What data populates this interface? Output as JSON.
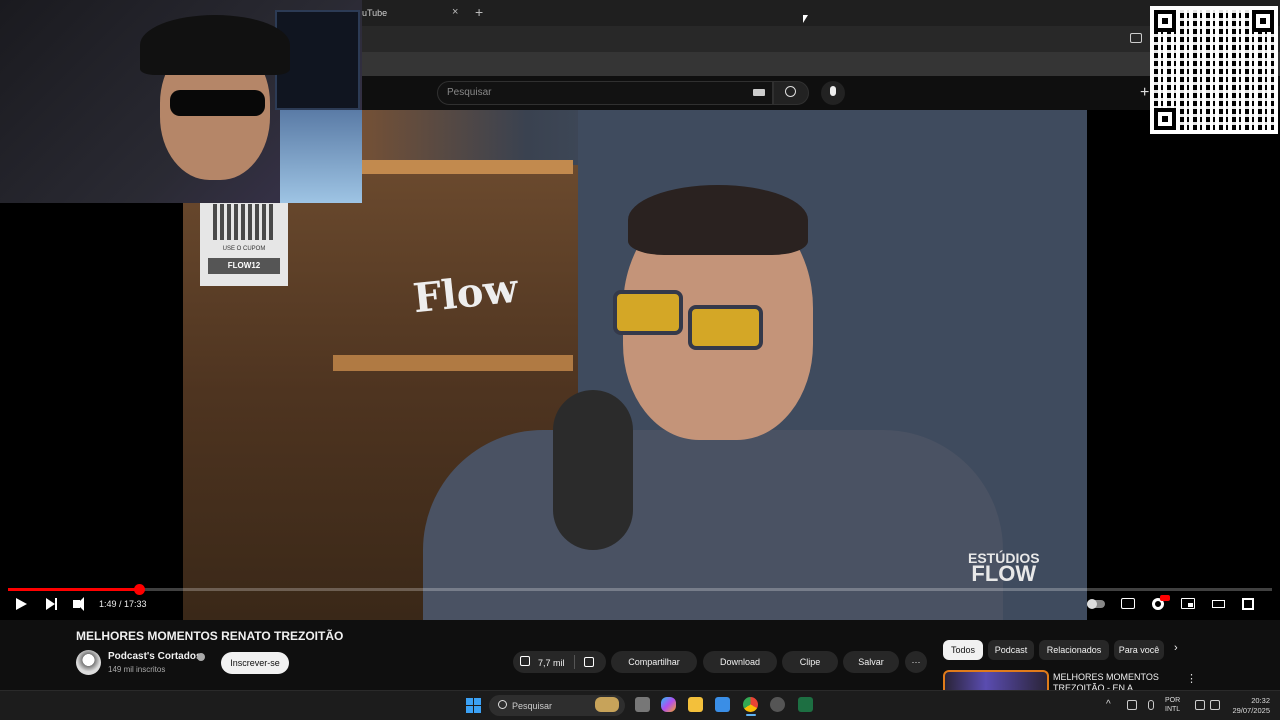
{
  "browser": {
    "tab_title": "uTube",
    "tab_close": "×",
    "new_tab": "+"
  },
  "header": {
    "search_placeholder": "Pesquisar",
    "create": "+"
  },
  "video": {
    "overlay_logo": "Flow",
    "coupon_text": "USE O CUPOM",
    "coupon_code": "FLOW12",
    "studio_line1": "ESTÚDIOS",
    "studio_line2": "FLOW",
    "time": "1:49 / 17:33",
    "progress_fraction": 0.1035
  },
  "meta": {
    "title": "MELHORES MOMENTOS RENATO TREZOITÃO",
    "channel": "Podcast's Cortados",
    "subscribers": "149 mil inscritos",
    "subscribe_label": "Inscrever-se",
    "likes": "7,7 mil",
    "share_label": "Compartilhar",
    "download_label": "Download",
    "clip_label": "Clipe",
    "save_label": "Salvar",
    "more_label": "···"
  },
  "chips": [
    "Todos",
    "Podcast",
    "Relacionados",
    "Para você"
  ],
  "chips_next": "›",
  "recommendation": {
    "title": "MELHORES MOMENTOS TREZOITÃO - EN A GLAUBER",
    "more": "⋮"
  },
  "taskbar": {
    "search_label": "Pesquisar",
    "tray_chevron": "^",
    "lang_line1": "POR",
    "lang_line2": "INTL",
    "time": "20:32",
    "date": "29/07/2025"
  }
}
